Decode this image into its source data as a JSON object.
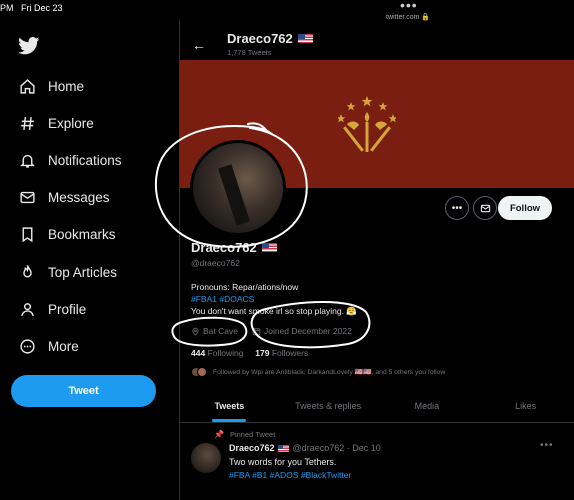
{
  "status": {
    "time": "PM",
    "date": "Fri Dec 23",
    "dots": "•••",
    "url": "twitter.com"
  },
  "sidebar": {
    "logo": "twitter-bird-icon",
    "items": [
      {
        "label": "Home",
        "icon": "home-icon"
      },
      {
        "label": "Explore",
        "icon": "hash-icon"
      },
      {
        "label": "Notifications",
        "icon": "bell-icon"
      },
      {
        "label": "Messages",
        "icon": "envelope-icon"
      },
      {
        "label": "Bookmarks",
        "icon": "bookmark-icon"
      },
      {
        "label": "Top Articles",
        "icon": "flame-icon"
      },
      {
        "label": "Profile",
        "icon": "person-icon"
      },
      {
        "label": "More",
        "icon": "more-circle-icon"
      }
    ],
    "tweet_button": "Tweet"
  },
  "header": {
    "back": "←",
    "name": "Draeco762",
    "tweets_count": "1,778 Tweets"
  },
  "colors": {
    "banner": "#7a1e12",
    "emblem": "#d4a63a",
    "accent": "#1d9bf0",
    "annotation": "#ffffff"
  },
  "profile": {
    "name": "Draeco762",
    "handle": "@draeco762",
    "bio_line1": "Pronouns: Repar/ations/now",
    "bio_tags": "#FBA1 #DOACS",
    "bio_line3": "You don't want smoke irl so stop playing. 😤",
    "location": "Bat Cave",
    "joined": "Joined December 2022",
    "following_count": "444",
    "following_label": "Following",
    "followers_count": "179",
    "followers_label": "Followers",
    "followed_by": "Followed by Wpi are Antiblack, DarkandLovely 🇺🇸🇺🇸, and 5 others you follow",
    "follow_button": "Follow",
    "more_button": "•••"
  },
  "tabs": [
    "Tweets",
    "Tweets & replies",
    "Media",
    "Likes"
  ],
  "pinned_tweet": {
    "pinned_label": "Pinned Tweet",
    "name": "Draeco762",
    "handle_date": "@draeco762 · Dec 10",
    "text": "Two words for you Tethers.",
    "tags": "#FBA #B1 #ADOS #BlackTwitter",
    "more": "•••"
  }
}
